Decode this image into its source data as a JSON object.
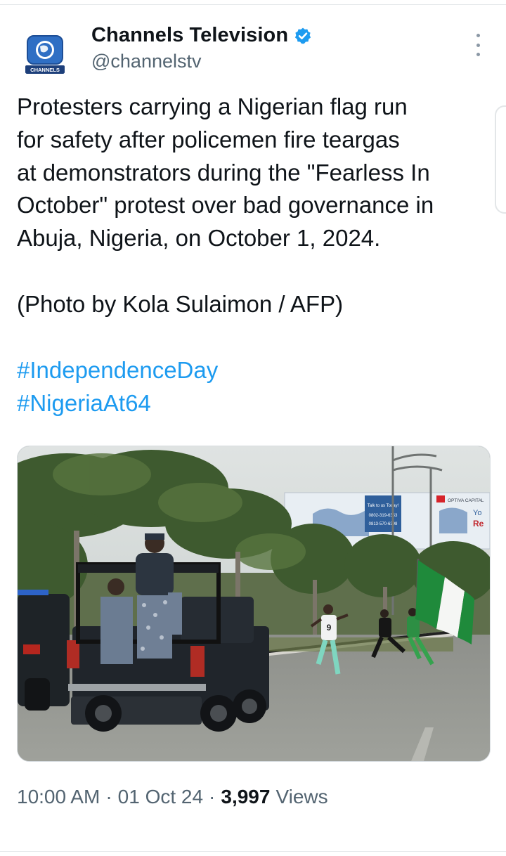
{
  "tweet": {
    "display_name": "Channels Television",
    "handle": "@channelstv",
    "verified": true,
    "avatar_label": "CHANNELS",
    "text": "Protesters carrying a Nigerian flag run\nfor safety after policemen fire teargas\nat demonstrators during the \"Fearless In\nOctober\" protest over bad governance in\nAbuja, Nigeria, on October 1, 2024.",
    "credit": "(Photo by Kola Sulaimon / AFP)",
    "hashtags": [
      "#IndependenceDay",
      "#NigeriaAt64"
    ],
    "time": "10:00 AM",
    "date": "01 Oct 24",
    "views_count": "3,997",
    "views_label": "Views"
  },
  "media": {
    "billboard_line1": "Talk to us Today!",
    "billboard_line2": "0802-319-6353",
    "billboard_line3": "0813-570-6398",
    "billboard_brand": "OPTIVA CAPITAL",
    "billboard_text_right": "Yo",
    "billboard_text_right2": "Re",
    "jersey_number": "9"
  },
  "colors": {
    "text": "#0f1419",
    "secondary": "#536471",
    "link": "#1d9bf0",
    "verified_badge": "#1d9bf0",
    "nigeria_green": "#1f8a3b"
  },
  "icons": {
    "verified": "verified-badge-icon",
    "more": "more-options-icon"
  }
}
